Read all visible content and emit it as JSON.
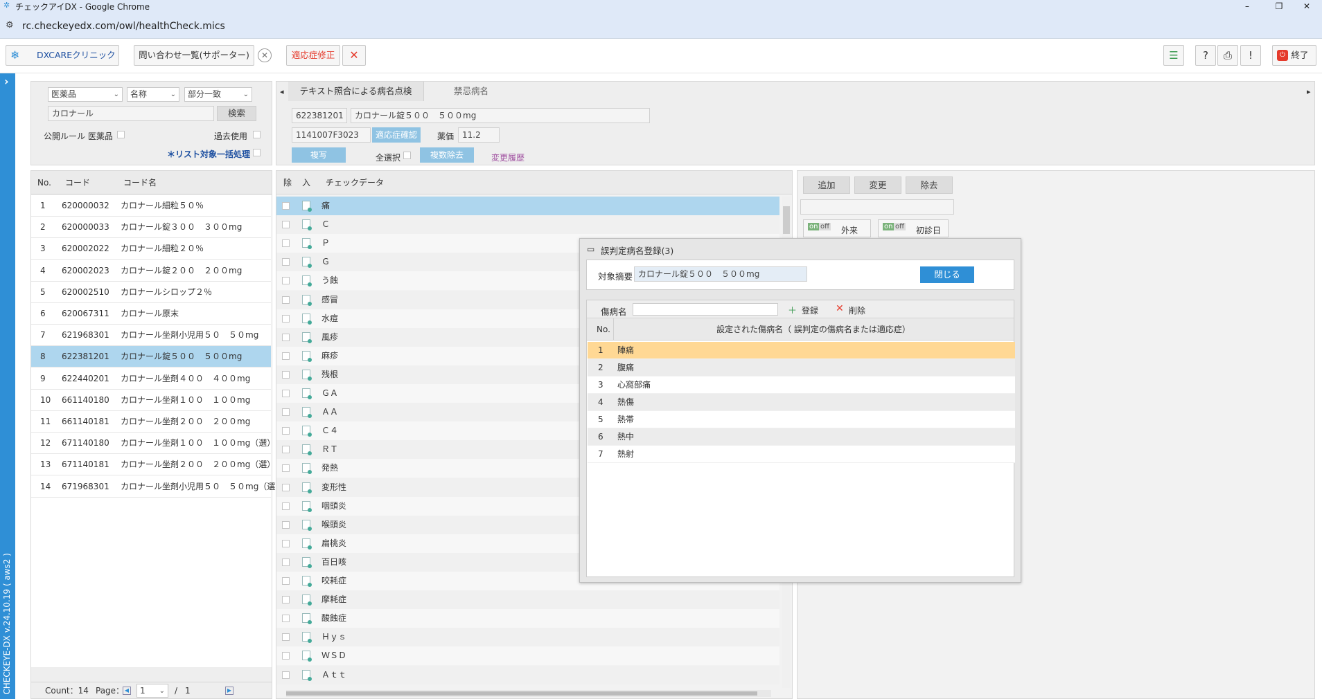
{
  "window": {
    "title": "チェックアイDX - Google Chrome",
    "url": "rc.checkeyedx.com/owl/healthCheck.mics",
    "minimize": "–",
    "restore": "❐",
    "close": "✕"
  },
  "toolbar": {
    "clinic": "DXCAREクリニック",
    "inquiry": "問い合わせ一覧(サポーター)",
    "adaptation": "適応症修正",
    "exit": "終了"
  },
  "sidebar": {
    "version": "CHECKEYE-DX v.24.10.19 ( aws2 )",
    "expand": "›"
  },
  "search": {
    "type": "医薬品",
    "field": "名称",
    "match": "部分一致",
    "query": "カロナール",
    "search_button": "検索",
    "public_rule": "公開ルール 医薬品",
    "past_use": "過去使用",
    "bulk": "＊リスト対象一括処理"
  },
  "codelist": {
    "headers": {
      "no": "No.",
      "code": "コード",
      "name": "コード名"
    },
    "rows": [
      {
        "no": "1",
        "code": "620000032",
        "name": "カロナール細粒５０％"
      },
      {
        "no": "2",
        "code": "620000033",
        "name": "カロナール錠３００　３００mg"
      },
      {
        "no": "3",
        "code": "620002022",
        "name": "カロナール細粒２０％"
      },
      {
        "no": "4",
        "code": "620002023",
        "name": "カロナール錠２００　２００mg"
      },
      {
        "no": "5",
        "code": "620002510",
        "name": "カロナールシロップ２％"
      },
      {
        "no": "6",
        "code": "620067311",
        "name": "カロナール原末"
      },
      {
        "no": "7",
        "code": "621968301",
        "name": "カロナール坐剤小児用５０　５０mg"
      },
      {
        "no": "8",
        "code": "622381201",
        "name": "カロナール錠５００　５００mg"
      },
      {
        "no": "9",
        "code": "622440201",
        "name": "カロナール坐剤４００　４００mg"
      },
      {
        "no": "10",
        "code": "661140180",
        "name": "カロナール坐剤１００　１００mg"
      },
      {
        "no": "11",
        "code": "661140181",
        "name": "カロナール坐剤２００　２００mg"
      },
      {
        "no": "12",
        "code": "671140180",
        "name": "カロナール坐剤１００　１００mg（選）"
      },
      {
        "no": "13",
        "code": "671140181",
        "name": "カロナール坐剤２００　２００mg（選）"
      },
      {
        "no": "14",
        "code": "671968301",
        "name": "カロナール坐剤小児用５０　５０mg（選）"
      }
    ],
    "count_label": "Count：14",
    "page_label": "Page：",
    "page_value": "1",
    "page_sep": "/",
    "page_total": "1"
  },
  "tabs": {
    "left_arrow": "◂",
    "right_arrow": "▸",
    "tab1": "テキスト照合による病名点検",
    "tab2": "禁忌病名"
  },
  "detail": {
    "code": "622381201",
    "name": "カロナール錠５００　５００mg",
    "yj": "1141007F3023",
    "confirm": "適応症確認",
    "price_label": "薬価",
    "price": "11.2",
    "copy": "複写",
    "select_all": "全選択",
    "multi_delete": "複数除去",
    "history": "変更履歴"
  },
  "checkdata": {
    "headers": {
      "del": "除",
      "in": "入",
      "data": "チェックデータ"
    },
    "rows": [
      "痛",
      "Ｃ",
      "Ｐ",
      "Ｇ",
      "う蝕",
      "感冒",
      "水痘",
      "風疹",
      "麻疹",
      "残根",
      "ＧＡ",
      "ＡＡ",
      "Ｃ４",
      "ＲＴ",
      "発熱",
      "変形性",
      "咽頭炎",
      "喉頭炎",
      "扁桃炎",
      "百日咳",
      "咬耗症",
      "摩耗症",
      "酸蝕症",
      "Ｈｙｓ",
      "ＷＳＤ",
      "Ａｔｔ"
    ]
  },
  "right": {
    "add": "追加",
    "change": "変更",
    "remove": "除去",
    "on": "on",
    "off": "off",
    "outpatient": "外来",
    "first_day": "初診日"
  },
  "dialog": {
    "title": "誤判定病名登録(3)",
    "target_label": "対象摘要",
    "target_value": "カロナール錠５００　５００mg",
    "close": "閉じる",
    "disease_label": "傷病名",
    "register": "登録",
    "delete": "削除",
    "no_header": "No.",
    "name_header": "設定された傷病名（ 誤判定の傷病名または適応症）",
    "rows": [
      {
        "no": "1",
        "name": "陣痛"
      },
      {
        "no": "2",
        "name": "腹痛"
      },
      {
        "no": "3",
        "name": "心窩部痛"
      },
      {
        "no": "4",
        "name": "熱傷"
      },
      {
        "no": "5",
        "name": "熱帯"
      },
      {
        "no": "6",
        "name": "熱中"
      },
      {
        "no": "7",
        "name": "熱射"
      }
    ]
  },
  "colors": {
    "accent": "#2f8fd6",
    "selected_row": "#aed6ee",
    "dialog_highlight": "#ffd894",
    "adaptation_text": "#e53b2c"
  }
}
